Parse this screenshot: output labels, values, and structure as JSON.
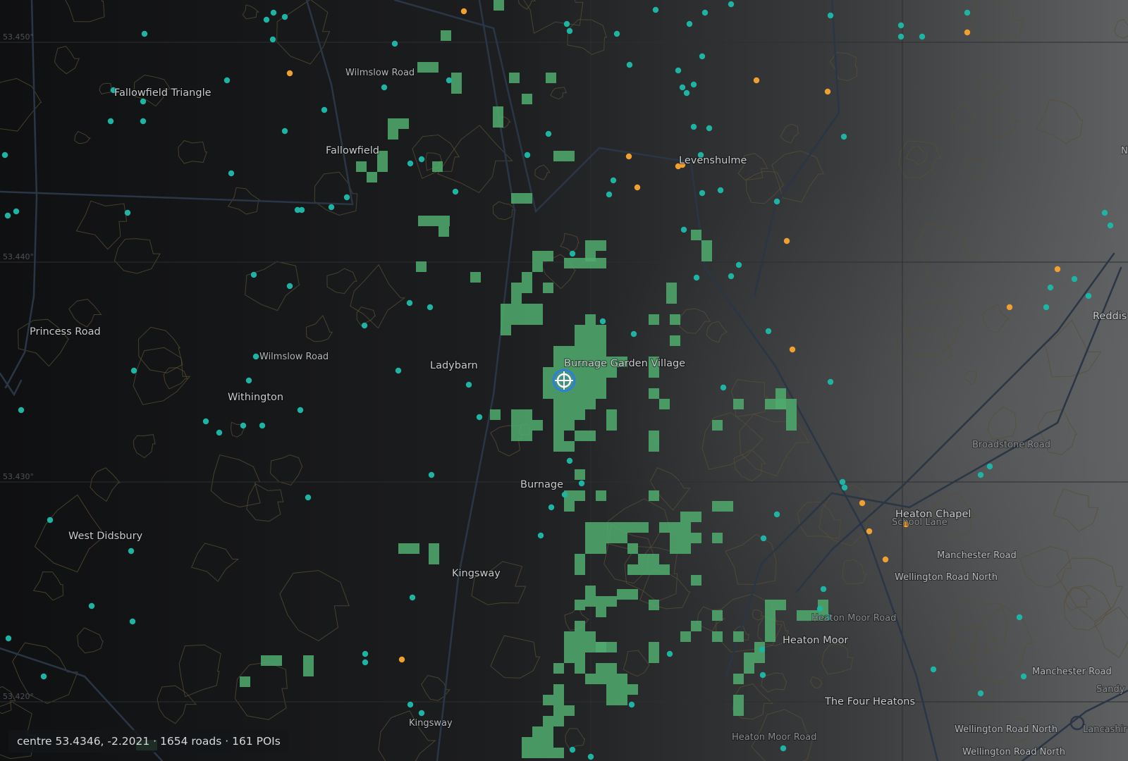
{
  "map": {
    "colors": {
      "background_dark": "#111213",
      "background_light": "#5a5c5e",
      "contour": "#5a4f36",
      "grid": "#2c2e31",
      "road": "#2a3646",
      "green_cell": "#4fa86c",
      "poi_teal": "#1fb3a4",
      "poi_orange": "#f0a030",
      "marker": "#2f7fd8"
    },
    "lat_labels": [
      "53.450°",
      "53.440°",
      "53.430°",
      "53.420°"
    ],
    "place_labels": [
      {
        "text": "Fallowfield Triangle"
      },
      {
        "text": "Fallowfield"
      },
      {
        "text": "Levenshulme"
      },
      {
        "text": "Princess Road"
      },
      {
        "text": "Ladybarn"
      },
      {
        "text": "Burnage Garden Village"
      },
      {
        "text": "Withington"
      },
      {
        "text": "Burnage"
      },
      {
        "text": "West Didsbury"
      },
      {
        "text": "Kingsway"
      },
      {
        "text": "Heaton Chapel"
      },
      {
        "text": "Heaton Moor"
      },
      {
        "text": "The Four Heatons"
      },
      {
        "text": "Reddis"
      }
    ],
    "road_labels": [
      {
        "text": "Wilmslow Road"
      },
      {
        "text": "Wilmslow Road"
      },
      {
        "text": "Kingsway"
      },
      {
        "text": "Broadstone Road"
      },
      {
        "text": "School Lane"
      },
      {
        "text": "Manchester Road"
      },
      {
        "text": "Wellington Road North"
      },
      {
        "text": "Heaton Moor Road"
      },
      {
        "text": "Manchester Road"
      },
      {
        "text": "Sandy"
      },
      {
        "text": "Heaton Moor Road"
      },
      {
        "text": "Wellington Road North"
      },
      {
        "text": "Wellington Road North"
      },
      {
        "text": "Lancashir"
      },
      {
        "text": "N"
      }
    ]
  },
  "status": {
    "text": "centre 53.4346, -2.2021 · 1654 roads · 161 POIs"
  }
}
